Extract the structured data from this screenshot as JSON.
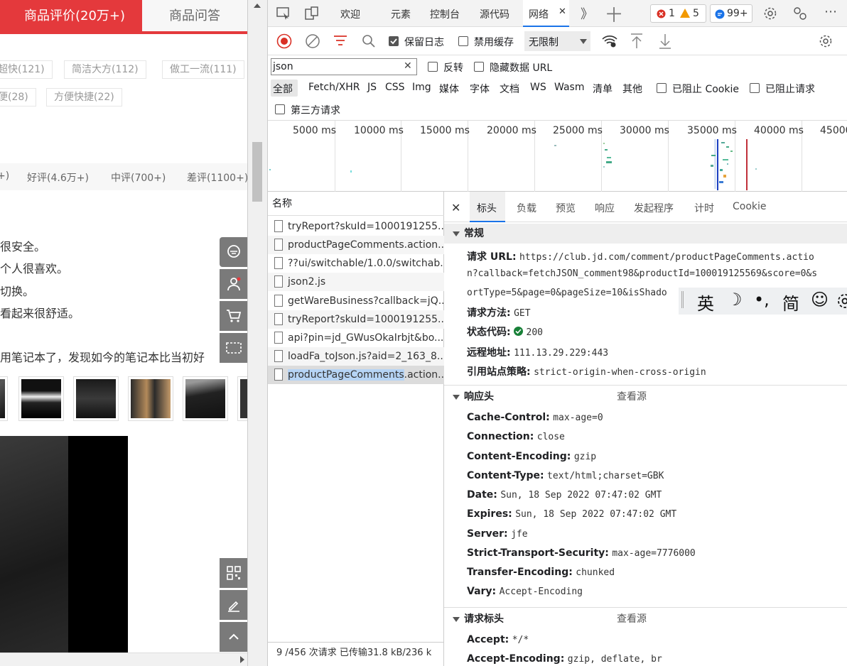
{
  "page": {
    "tabs": {
      "reviews": "商品评价(20万+)",
      "qa": "商品问答"
    },
    "tags": [
      "超快(121)",
      "简洁大方(112)",
      "做工一流(111)",
      "便(28)",
      "方便快捷(22)"
    ],
    "filters": [
      "+)",
      "好评(4.6万+)",
      "中评(700+)",
      "差评(1100+)"
    ],
    "review_lines": [
      "很安全。",
      "个人很喜欢。",
      "切换。",
      "看起来很舒适。",
      "用笔记本了，发现如今的笔记本比当初好"
    ]
  },
  "devtools": {
    "tabs": [
      "欢迎",
      "元素",
      "控制台",
      "源代码",
      "网络",
      "》",
      "十"
    ],
    "active_tab": "网络",
    "close_glyph": "✕",
    "badges": {
      "errors": "1",
      "warnings": "5",
      "messages": "99+"
    },
    "toolbar": {
      "preserve_log": "保留日志",
      "disable_cache": "禁用缓存",
      "throttle": "无限制"
    },
    "filter": {
      "value": "json",
      "invert": "反转",
      "hide_data_urls": "隐藏数据 URL",
      "types": [
        "全部",
        "Fetch/XHR",
        "JS",
        "CSS",
        "Img",
        "媒体",
        "字体",
        "文档",
        "WS",
        "Wasm",
        "清单",
        "其他"
      ],
      "blocked_cookies": "已阻止 Cookie",
      "blocked_requests": "已阻止请求",
      "third_party": "第三方请求"
    },
    "timeline": [
      "5000 ms",
      "10000 ms",
      "15000 ms",
      "20000 ms",
      "25000 ms",
      "30000 ms",
      "35000 ms",
      "40000 ms",
      "45000"
    ],
    "requests": {
      "header": "名称",
      "rows": [
        "tryReport?skuId=1000191255...",
        "productPageComments.action...",
        "??ui/switchable/1.0.0/switchab...",
        "json2.js",
        "getWareBusiness?callback=jQ...",
        "tryReport?skuId=1000191255...",
        "api?pin=jd_GWusOkaIrbjt&bo...",
        "loadFa_toJson.js?aid=2_163_8...",
        "productPageComments.action..."
      ],
      "selected_name": "productPageComments",
      "selected_rest": ".action...",
      "footer": "9 /456 次请求  已传输31.8 kB/236 k"
    },
    "detail": {
      "tabs": [
        "标头",
        "负载",
        "预览",
        "响应",
        "发起程序",
        "计时",
        "Cookie"
      ],
      "general_title": "常规",
      "general": {
        "url_key": "请求 URL:",
        "url_1": "https://club.jd.com/comment/productPageComments.actio",
        "url_2": "n?callback=fetchJSON_comment98&productId=100019125569&score=0&s",
        "url_3": "ortType=5&page=0&pageSize=10&isShado",
        "method_key": "请求方法:",
        "method": "GET",
        "status_key": "状态代码:",
        "status": "200",
        "remote_key": "远程地址:",
        "remote": "111.13.29.229:443",
        "policy_key": "引用站点策略:",
        "policy": "strict-origin-when-cross-origin"
      },
      "response_title": "响应头",
      "view_source": "查看源",
      "response_headers": [
        {
          "k": "Cache-Control:",
          "v": "max-age=0"
        },
        {
          "k": "Connection:",
          "v": "close"
        },
        {
          "k": "Content-Encoding:",
          "v": "gzip"
        },
        {
          "k": "Content-Type:",
          "v": "text/html;charset=GBK"
        },
        {
          "k": "Date:",
          "v": "Sun, 18 Sep 2022 07:47:02 GMT"
        },
        {
          "k": "Expires:",
          "v": "Sun, 18 Sep 2022 07:47:02 GMT"
        },
        {
          "k": "Server:",
          "v": "jfe"
        },
        {
          "k": "Strict-Transport-Security:",
          "v": "max-age=7776000"
        },
        {
          "k": "Transfer-Encoding:",
          "v": "chunked"
        },
        {
          "k": "Vary:",
          "v": "Accept-Encoding"
        }
      ],
      "request_title": "请求标头",
      "request_headers": [
        {
          "k": "Accept:",
          "v": "*/*"
        },
        {
          "k": "Accept-Encoding:",
          "v": "gzip, deflate, br"
        }
      ]
    }
  },
  "ime": {
    "lang": "英",
    "moon": "☽",
    "punct": "•,",
    "mode": "简",
    "emoji": "☺"
  }
}
